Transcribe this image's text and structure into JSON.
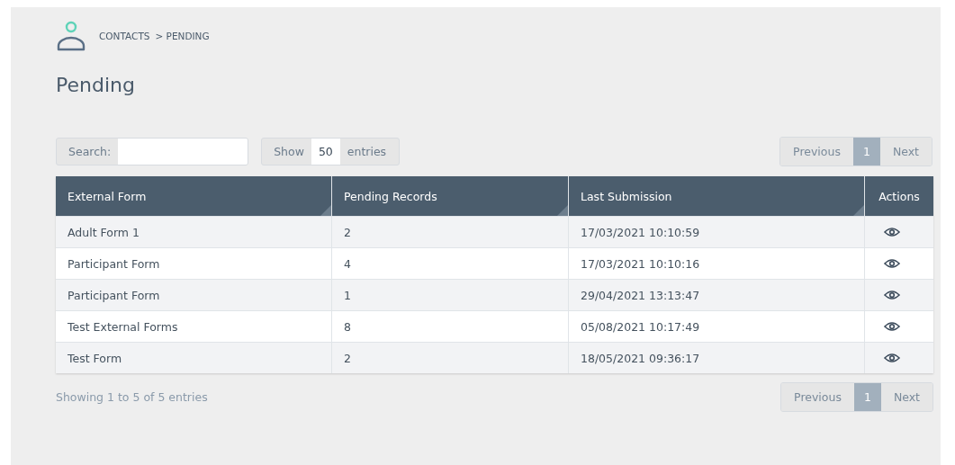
{
  "breadcrumb": [
    "CONTACTS",
    "> PENDING"
  ],
  "title": "Pending",
  "search": {
    "label": "Search:"
  },
  "length": {
    "prefix": "Show",
    "value": "50",
    "suffix": "entries"
  },
  "pagination_top": [
    {
      "label": "Previous",
      "kind": "nav",
      "selected": false
    },
    {
      "label": "1",
      "kind": "page",
      "selected": true
    },
    {
      "label": "Next",
      "kind": "nav",
      "selected": false
    }
  ],
  "table": {
    "columns": [
      {
        "label": "External Form",
        "sortable": true
      },
      {
        "label": "Pending Records",
        "sortable": true
      },
      {
        "label": "Last Submission",
        "sortable": true
      },
      {
        "label": "Actions",
        "sortable": false
      }
    ],
    "rows": [
      {
        "cells": [
          "Adult Form 1",
          "2",
          "17/03/2021 10:10:59"
        ]
      },
      {
        "cells": [
          "Participant Form",
          "4",
          "17/03/2021 10:10:16"
        ]
      },
      {
        "cells": [
          "Participant Form",
          "1",
          "29/04/2021 13:13:47"
        ]
      },
      {
        "cells": [
          "Test External Forms",
          "8",
          "05/08/2021 10:17:49"
        ]
      },
      {
        "cells": [
          "Test Form",
          "2",
          "18/05/2021 09:36:17"
        ]
      }
    ]
  },
  "info": "Showing 1 to 5 of 5 entries",
  "pagination_bottom": [
    {
      "label": "Previous",
      "kind": "nav",
      "selected": false
    },
    {
      "label": "1",
      "kind": "page",
      "selected": true
    },
    {
      "label": "Next",
      "kind": "nav",
      "selected": false
    }
  ]
}
